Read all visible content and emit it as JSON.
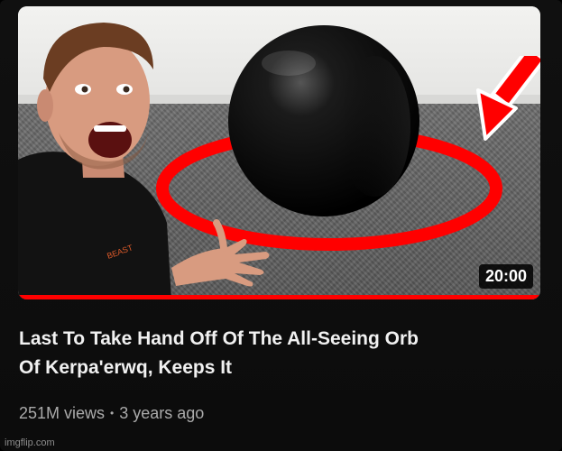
{
  "video": {
    "duration": "20:00",
    "title_line1": "Last To Take Hand Off Of The All-Seeing Orb",
    "title_line2": "Of Kerpa'erwq, Keeps It",
    "views": "251M views",
    "separator": "•",
    "age": "3 years ago",
    "progress_fraction": 1.0
  },
  "watermark": "imgflip.com",
  "colors": {
    "accent_red": "#ff0000",
    "background": "#0f0f0f",
    "title_text": "#f1f1f1",
    "meta_text": "#aaaaaa"
  }
}
